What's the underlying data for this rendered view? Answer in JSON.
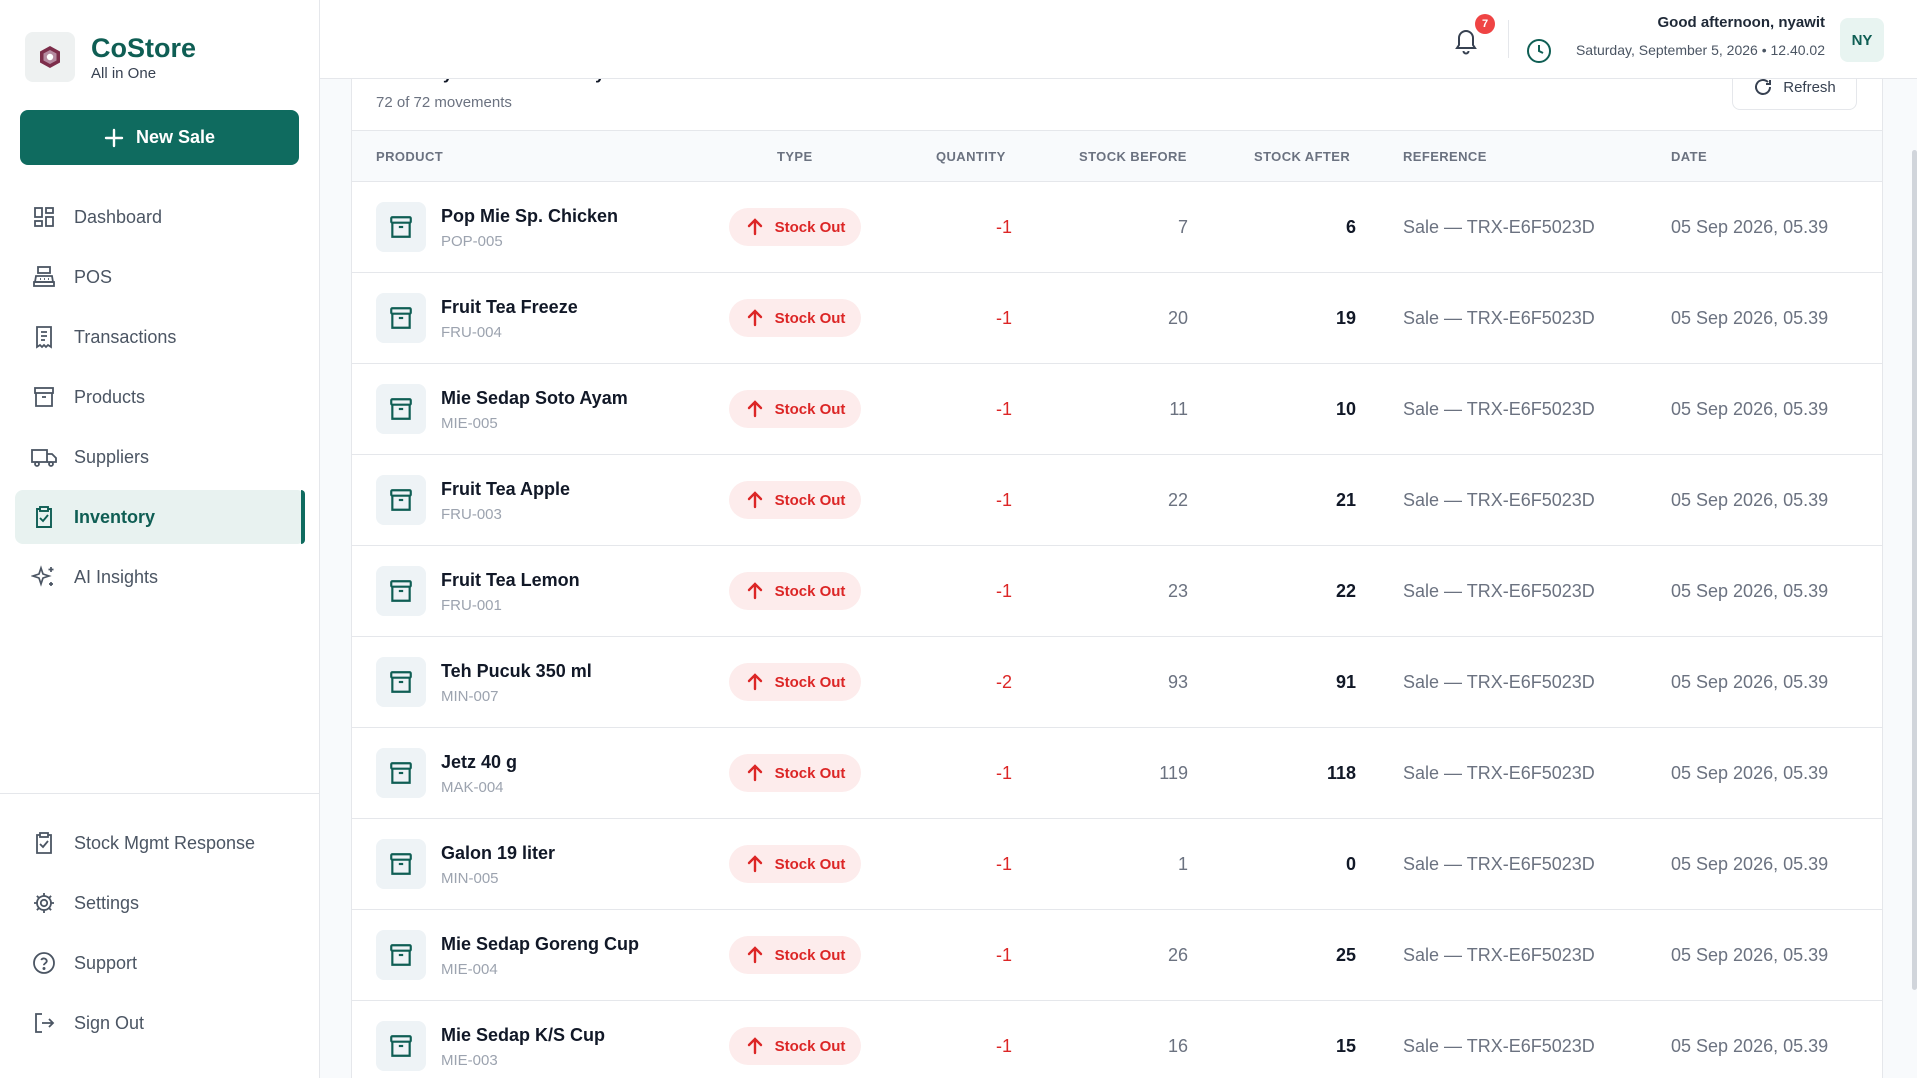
{
  "brand": {
    "name": "CoStore",
    "subtitle": "All in One"
  },
  "new_sale_label": "New Sale",
  "sidebar": {
    "items": [
      {
        "label": "Dashboard",
        "icon": "dashboard-icon"
      },
      {
        "label": "POS",
        "icon": "pos-register-icon"
      },
      {
        "label": "Transactions",
        "icon": "receipt-icon"
      },
      {
        "label": "Products",
        "icon": "archive-box-icon"
      },
      {
        "label": "Suppliers",
        "icon": "truck-icon"
      },
      {
        "label": "Inventory",
        "icon": "clipboard-check-icon",
        "active": true
      },
      {
        "label": "AI Insights",
        "icon": "sparkles-icon"
      }
    ],
    "bottom_items": [
      {
        "label": "Stock Mgmt Response",
        "icon": "clipboard-check-icon"
      },
      {
        "label": "Settings",
        "icon": "gear-icon"
      },
      {
        "label": "Support",
        "icon": "help-circle-icon"
      },
      {
        "label": "Sign Out",
        "icon": "sign-out-icon"
      }
    ]
  },
  "header": {
    "notification_count": "7",
    "greeting": "Good afternoon, nyawit",
    "datetime": "Saturday, September 5, 2026 • 12.40.02",
    "avatar_initials": "NY"
  },
  "card": {
    "title": "Inventory Movement History",
    "subtitle": "72 of 72 movements",
    "refresh_label": "Refresh"
  },
  "table": {
    "headers": {
      "product": "PRODUCT",
      "type": "TYPE",
      "quantity": "QUANTITY",
      "stock_before": "STOCK BEFORE",
      "stock_after": "STOCK AFTER",
      "reference": "REFERENCE",
      "date": "DATE"
    },
    "rows": [
      {
        "name": "Pop Mie Sp. Chicken",
        "sku": "POP-005",
        "type": "Stock Out",
        "qty": "-1",
        "before": "7",
        "after": "6",
        "ref": "Sale — TRX-E6F5023D",
        "date": "05 Sep 2026, 05.39"
      },
      {
        "name": "Fruit Tea Freeze",
        "sku": "FRU-004",
        "type": "Stock Out",
        "qty": "-1",
        "before": "20",
        "after": "19",
        "ref": "Sale — TRX-E6F5023D",
        "date": "05 Sep 2026, 05.39"
      },
      {
        "name": "Mie Sedap Soto Ayam",
        "sku": "MIE-005",
        "type": "Stock Out",
        "qty": "-1",
        "before": "11",
        "after": "10",
        "ref": "Sale — TRX-E6F5023D",
        "date": "05 Sep 2026, 05.39"
      },
      {
        "name": "Fruit Tea Apple",
        "sku": "FRU-003",
        "type": "Stock Out",
        "qty": "-1",
        "before": "22",
        "after": "21",
        "ref": "Sale — TRX-E6F5023D",
        "date": "05 Sep 2026, 05.39"
      },
      {
        "name": "Fruit Tea Lemon",
        "sku": "FRU-001",
        "type": "Stock Out",
        "qty": "-1",
        "before": "23",
        "after": "22",
        "ref": "Sale — TRX-E6F5023D",
        "date": "05 Sep 2026, 05.39"
      },
      {
        "name": "Teh Pucuk 350 ml",
        "sku": "MIN-007",
        "type": "Stock Out",
        "qty": "-2",
        "before": "93",
        "after": "91",
        "ref": "Sale — TRX-E6F5023D",
        "date": "05 Sep 2026, 05.39"
      },
      {
        "name": "Jetz 40 g",
        "sku": "MAK-004",
        "type": "Stock Out",
        "qty": "-1",
        "before": "119",
        "after": "118",
        "ref": "Sale — TRX-E6F5023D",
        "date": "05 Sep 2026, 05.39"
      },
      {
        "name": "Galon 19 liter",
        "sku": "MIN-005",
        "type": "Stock Out",
        "qty": "-1",
        "before": "1",
        "after": "0",
        "ref": "Sale — TRX-E6F5023D",
        "date": "05 Sep 2026, 05.39"
      },
      {
        "name": "Mie Sedap Goreng Cup",
        "sku": "MIE-004",
        "type": "Stock Out",
        "qty": "-1",
        "before": "26",
        "after": "25",
        "ref": "Sale — TRX-E6F5023D",
        "date": "05 Sep 2026, 05.39"
      },
      {
        "name": "Mie Sedap K/S Cup",
        "sku": "MIE-003",
        "type": "Stock Out",
        "qty": "-1",
        "before": "16",
        "after": "15",
        "ref": "Sale — TRX-E6F5023D",
        "date": "05 Sep 2026, 05.39"
      }
    ]
  },
  "colors": {
    "brand": "#0f6b5f",
    "stock_out": "#dc2626",
    "badge_bg": "#fdecec"
  }
}
